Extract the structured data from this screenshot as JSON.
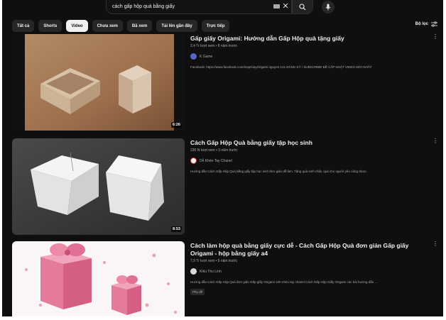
{
  "search": {
    "query": "cách gấp hộp quà bằng giấy"
  },
  "chips": [
    "Tất cả",
    "Shorts",
    "Video",
    "Chưa xem",
    "Đã xem",
    "Tải lên gần đây",
    "Trực tiếp"
  ],
  "active_chip": "Video",
  "filters_label": "Bộ lọc",
  "results": [
    {
      "title": "Gấp giấy Origami: Hướng dẫn Gấp Hộp quà tặng giấy",
      "meta": "2,4 Tr lượt xem • 8 năm trước",
      "channel": "K Game",
      "description": "Facebook: https://www.facebook.com/GapGiayOrigami.nguyen.121 ĐĂNG KÝ / SUBSCRIBE ĐỂ CẬP NHẬT VIDEO MỚI NHẤT",
      "duration": "6:26",
      "badge": ""
    },
    {
      "title": "Cách Gấp Hộp Quà bằng giấy tập học sinh",
      "meta": "230 N lượt xem • 3 năm trước",
      "channel": "Dễ Khéo Tay Chanel",
      "description": "Hướng dẫn Cách Gấp Hộp Quà bằng giấy tập học sinh đơn giản dễ làm. Tặng quà sinh nhật, quà cho người yêu cũng được.",
      "duration": "8:53",
      "badge": ""
    },
    {
      "title": "Cách làm hộp quà bằng giấy cực dễ - Cách Gấp Hộp Quà đơn giản Gấp giấy Origami - hộp bằng giấy a4",
      "meta": "7,9 Tr lượt xem • 5 năm trước",
      "channel": "Kiều Thu Linh",
      "description": "Hướng dẫn Cách Gấp Hộp Quà đơn giản Gấp giấy Origami 24h nhéo tay chanel Cách Gấp Hộp Giấy Origami các bài hướng dẫn ...",
      "duration": "",
      "badge": "Phụ đề"
    }
  ],
  "colors": {
    "background": "#0f0f0f",
    "chip": "#272727",
    "chip_active": "#f1f1f1",
    "text_primary": "#f1f1f1",
    "text_secondary": "#aaaaaa"
  },
  "icons": [
    "keyboard-icon",
    "close-icon",
    "search-icon",
    "mic-icon",
    "filter-icon",
    "more-vert-icon",
    "channel-avatar"
  ]
}
